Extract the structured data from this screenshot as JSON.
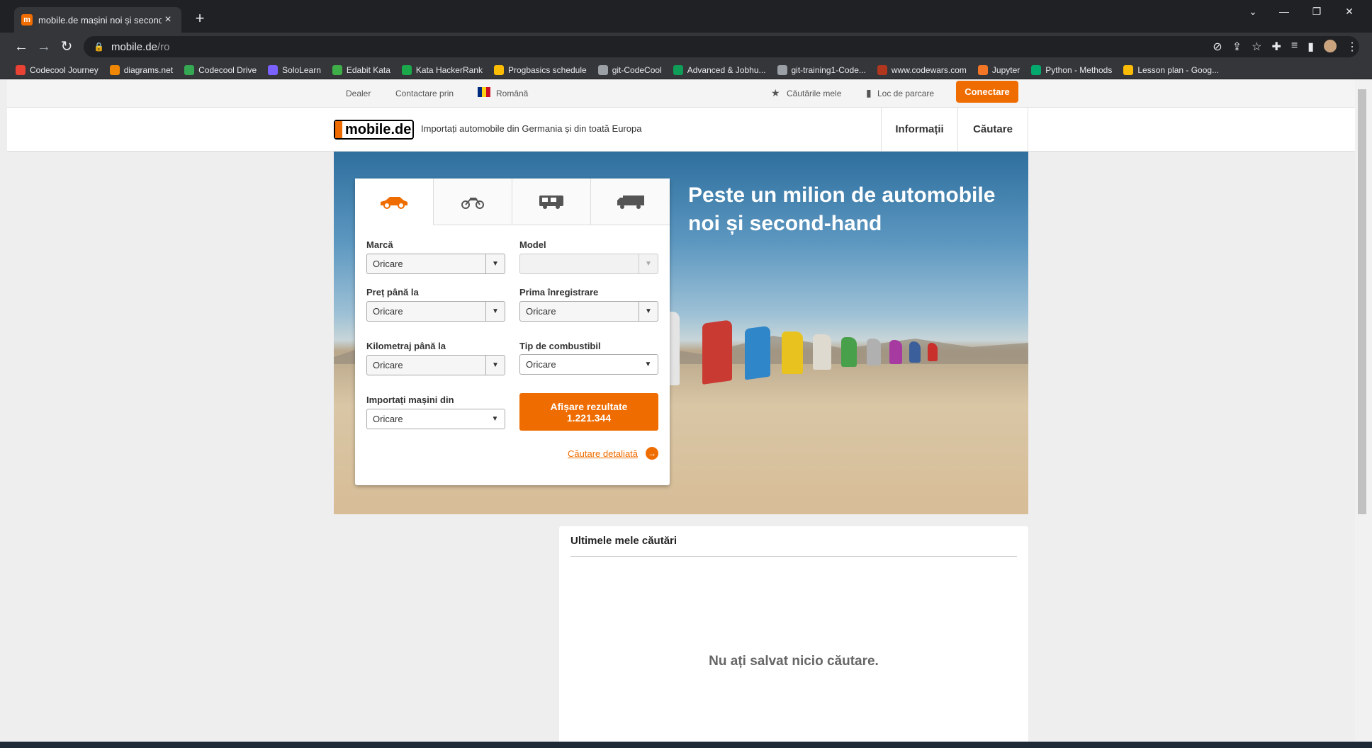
{
  "browser": {
    "tab_title": "mobile.de mașini noi și second-h",
    "tab_favicon": "m",
    "url_host": "mobile.de",
    "url_path": "/ro",
    "bookmarks": [
      {
        "label": "Codecool Journey",
        "icon_color": "#e94235"
      },
      {
        "label": "diagrams.net",
        "icon_color": "#f08705"
      },
      {
        "label": "Codecool Drive",
        "icon_color": "#34a853"
      },
      {
        "label": "SoloLearn",
        "icon_color": "#7b61ff"
      },
      {
        "label": "Edabit Kata",
        "icon_color": "#3fae49"
      },
      {
        "label": "Kata HackerRank",
        "icon_color": "#1ba94c"
      },
      {
        "label": "Progbasics schedule",
        "icon_color": "#fbbc04"
      },
      {
        "label": "git-CodeCool",
        "icon_color": "#9aa0a6"
      },
      {
        "label": "Advanced & Jobhu...",
        "icon_color": "#0f9d58"
      },
      {
        "label": "git-training1-Code...",
        "icon_color": "#9aa0a6"
      },
      {
        "label": "www.codewars.com",
        "icon_color": "#b1361e"
      },
      {
        "label": "Jupyter",
        "icon_color": "#f37626"
      },
      {
        "label": "Python - Methods",
        "icon_color": "#04aa6d"
      },
      {
        "label": "Lesson plan - Goog...",
        "icon_color": "#fbbc04"
      }
    ]
  },
  "topbar": {
    "dealer": "Dealer",
    "contact": "Contactare prin",
    "language": "Română",
    "saved_searches": "Căutările mele",
    "parking": "Loc de parcare",
    "login": "Conectare"
  },
  "header": {
    "logo": "mobile.de",
    "tagline": "Importați automobile din Germania și din toată Europa",
    "nav_info": "Informații",
    "nav_search": "Căutare"
  },
  "hero": {
    "title_line1": "Peste un milion de automobile",
    "title_line2": "noi și second-hand"
  },
  "search": {
    "vehicle_tabs": [
      "car-icon",
      "motorbike-icon",
      "camper-icon",
      "truck-icon"
    ],
    "make_label": "Marcă",
    "make_value": "Oricare",
    "model_label": "Model",
    "model_value": "",
    "price_label": "Preț până la",
    "price_value": "Oricare",
    "registration_label": "Prima înregistrare",
    "registration_value": "Oricare",
    "mileage_label": "Kilometraj până la",
    "mileage_value": "Oricare",
    "fuel_label": "Tip de combustibil",
    "fuel_value": "Oricare",
    "import_label": "Importați mașini din",
    "import_value": "Oricare",
    "show_results_label": "Afișare rezultate",
    "show_results_count": "1.221.344",
    "detailed_search": "Căutare detaliată"
  },
  "recent": {
    "title": "Ultimele mele căutări",
    "empty": "Nu ați salvat nicio căutare."
  },
  "colors": {
    "accent": "#ef6c00"
  }
}
